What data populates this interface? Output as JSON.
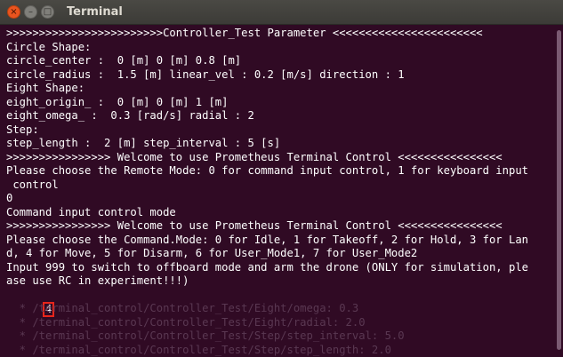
{
  "window": {
    "title": "Terminal",
    "close_glyph": "×",
    "minimize_glyph": "–",
    "maximize_glyph": "□"
  },
  "terminal": {
    "lines": [
      ">>>>>>>>>>>>>>>>>>>>>>>>Controller_Test Parameter <<<<<<<<<<<<<<<<<<<<<<<",
      "Circle Shape:",
      "circle_center :  0 [m] 0 [m] 0.8 [m]",
      "circle_radius :  1.5 [m] linear_vel : 0.2 [m/s] direction : 1",
      "Eight Shape:",
      "eight_origin_ :  0 [m] 0 [m] 1 [m]",
      "eight_omega_ :  0.3 [rad/s] radial : 2",
      "Step:",
      "step_length :  2 [m] step_interval : 5 [s]",
      ">>>>>>>>>>>>>>>> Welcome to use Prometheus Terminal Control <<<<<<<<<<<<<<<<",
      "Please choose the Remote Mode: 0 for command input control, 1 for keyboard input",
      " control",
      "0",
      "Command input control mode",
      ">>>>>>>>>>>>>>>> Welcome to use Prometheus Terminal Control <<<<<<<<<<<<<<<<",
      "Please choose the Command.Mode: 0 for Idle, 1 for Takeoff, 2 for Hold, 3 for Lan",
      "d, 4 for Move, 5 for Disarm, 6 for User_Mode1, 7 for User_Mode2",
      "Input 999 to switch to offboard mode and arm the drone (ONLY for simulation, ple",
      "ase use RC in experiment!!!)"
    ],
    "input_value": "4",
    "ghost_lines": [
      "  * /terminal_control/Controller_Test/Step/step_interval: 5.0",
      "  * /terminal_control/Controller_Test/Step/step_length: 2.0"
    ],
    "ghost_mid": [
      "  * /terminal_control/Controller_Test/Eight/omega: 0.3",
      "  * /terminal_control/Controller_Test/Eight/radial: 2.0"
    ]
  },
  "colors": {
    "background": "#300a24",
    "text": "#ffffff",
    "cursor_highlight": "#e8261c"
  }
}
